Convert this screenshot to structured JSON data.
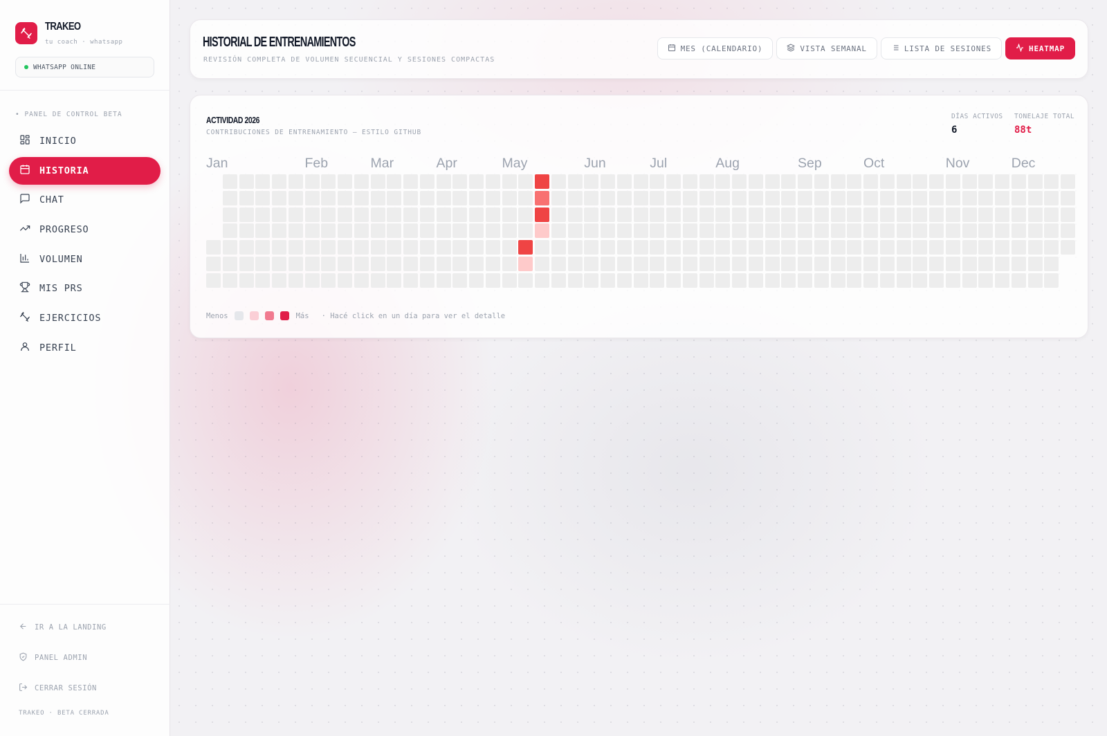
{
  "brand": {
    "name": "TRAKEO",
    "tagline": "tu coach · whatsapp",
    "status": "WHATSAPP ONLINE"
  },
  "sidebar": {
    "section_label": "• PANEL DE CONTROL BETA",
    "items": [
      {
        "label": "INICIO",
        "icon": "dashboard-icon",
        "active": false
      },
      {
        "label": "HISTORIA",
        "icon": "calendar-icon",
        "active": true
      },
      {
        "label": "CHAT",
        "icon": "chat-icon",
        "active": false
      },
      {
        "label": "PROGRESO",
        "icon": "trending-up-icon",
        "active": false
      },
      {
        "label": "VOLUMEN",
        "icon": "bar-chart-icon",
        "active": false
      },
      {
        "label": "MIS PRS",
        "icon": "trophy-icon",
        "active": false
      },
      {
        "label": "EJERCICIOS",
        "icon": "dumbbell-icon",
        "active": false
      },
      {
        "label": "PERFIL",
        "icon": "user-icon",
        "active": false
      }
    ],
    "footer_links": [
      {
        "label": "IR A LA LANDING",
        "icon": "arrow-left-icon"
      },
      {
        "label": "PANEL ADMIN",
        "icon": "shield-icon"
      },
      {
        "label": "CERRAR SESIÓN",
        "icon": "logout-icon"
      }
    ],
    "footer_note": "TRAKEO · BETA CERRADA"
  },
  "header": {
    "title": "HISTORIAL DE ENTRENAMIENTOS",
    "subtitle": "REVISIÓN COMPLETA DE VOLUMEN SECUENCIAL Y SESIONES COMPACTAS",
    "tabs": [
      {
        "label": "MES (CALENDARIO)",
        "icon": "calendar-icon",
        "active": false
      },
      {
        "label": "VISTA SEMANAL",
        "icon": "layers-icon",
        "active": false
      },
      {
        "label": "LISTA DE SESIONES",
        "icon": "list-icon",
        "active": false
      },
      {
        "label": "HEATMAP",
        "icon": "activity-icon",
        "active": true
      }
    ]
  },
  "activity": {
    "title": "ACTIVIDAD 2026",
    "subtitle": "CONTRIBUCIONES DE ENTRENAMIENTO — ESTILO GITHUB",
    "stats": [
      {
        "label": "DÍAS ACTIVOS",
        "value": "6"
      },
      {
        "label": "TONELAJE TOTAL",
        "value": "88t"
      }
    ],
    "months": [
      "Jan",
      "Feb",
      "Mar",
      "Apr",
      "May",
      "Jun",
      "Jul",
      "Aug",
      "Sep",
      "Oct",
      "Nov",
      "Dec"
    ],
    "legend": {
      "less": "Menos",
      "more": "Más",
      "hint": "· Hacé click en un día para ver el detalle"
    },
    "level_colors": [
      "#ededed",
      "#fecaca",
      "#f87171",
      "#ef4444"
    ],
    "active_days": [
      {
        "date": "2026-05-17",
        "level": 3
      },
      {
        "date": "2026-05-18",
        "level": 2
      },
      {
        "date": "2026-05-19",
        "level": 3
      },
      {
        "date": "2026-05-20",
        "level": 1
      },
      {
        "date": "2026-05-14",
        "level": 3
      },
      {
        "date": "2026-05-15",
        "level": 1
      }
    ]
  },
  "colors": {
    "accent": "#e11d48",
    "online": "#22c55e"
  }
}
